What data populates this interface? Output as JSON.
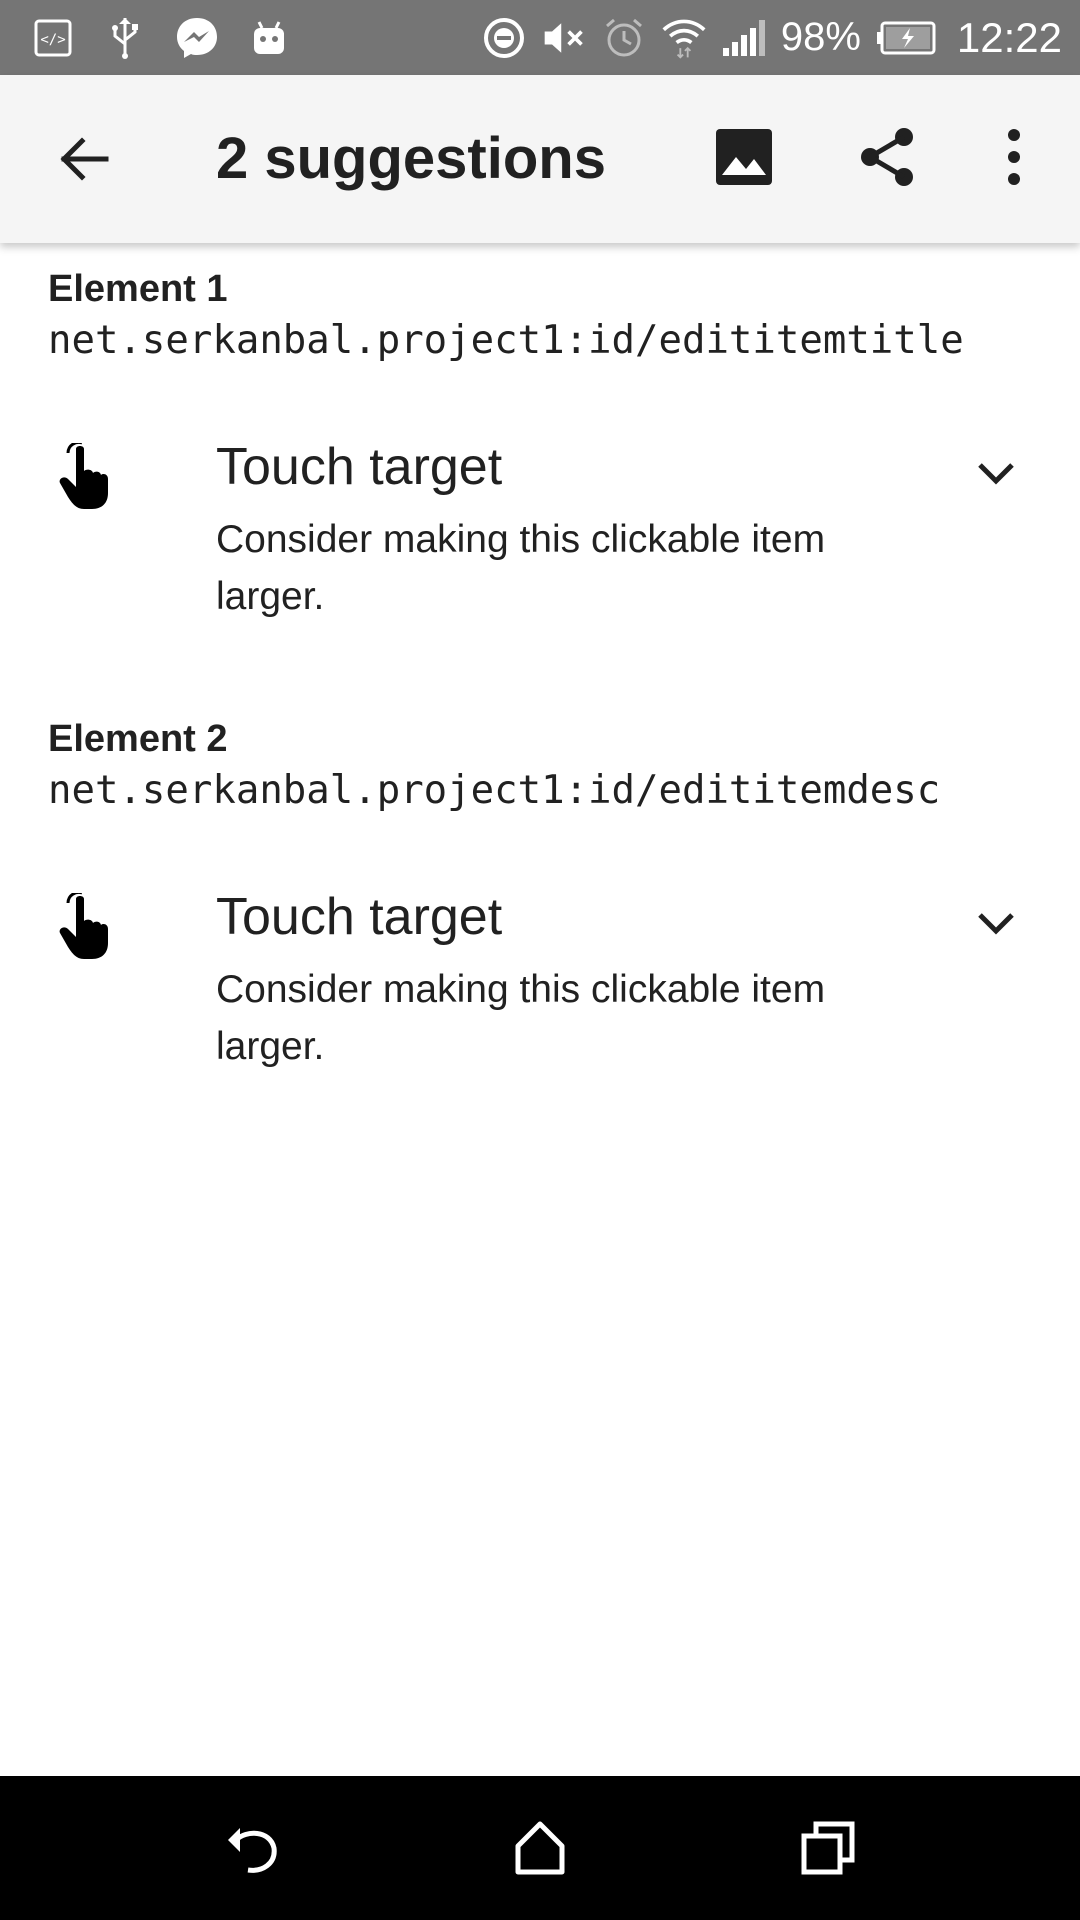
{
  "status_bar": {
    "battery_percent": "98%",
    "time": "12:22",
    "icons": [
      "code-icon",
      "usb-icon",
      "messenger-icon",
      "android-icon",
      "dnd-icon",
      "mute-icon",
      "alarm-icon",
      "wifi-icon",
      "signal-icon",
      "battery-charging-icon"
    ]
  },
  "app_bar": {
    "title": "2 suggestions",
    "icons": [
      "back-arrow-icon",
      "image-icon",
      "share-icon",
      "more-vert-icon"
    ]
  },
  "elements": [
    {
      "label": "Element 1",
      "id": "net.serkanbal.project1:id/edititemtitle",
      "suggestion": {
        "title": "Touch target",
        "description": "Consider making this clickable item larger.",
        "icon": "touch-hand-icon"
      }
    },
    {
      "label": "Element 2",
      "id": "net.serkanbal.project1:id/edititemdesc",
      "suggestion": {
        "title": "Touch target",
        "description": "Consider making this clickable item larger.",
        "icon": "touch-hand-icon"
      }
    }
  ],
  "nav_bar": {
    "icons": [
      "nav-back-icon",
      "nav-home-icon",
      "nav-recents-icon"
    ]
  },
  "colors": {
    "status_bar": "#757575",
    "app_bar": "#f5f5f5",
    "nav_bar": "#000000",
    "text": "#212121"
  }
}
